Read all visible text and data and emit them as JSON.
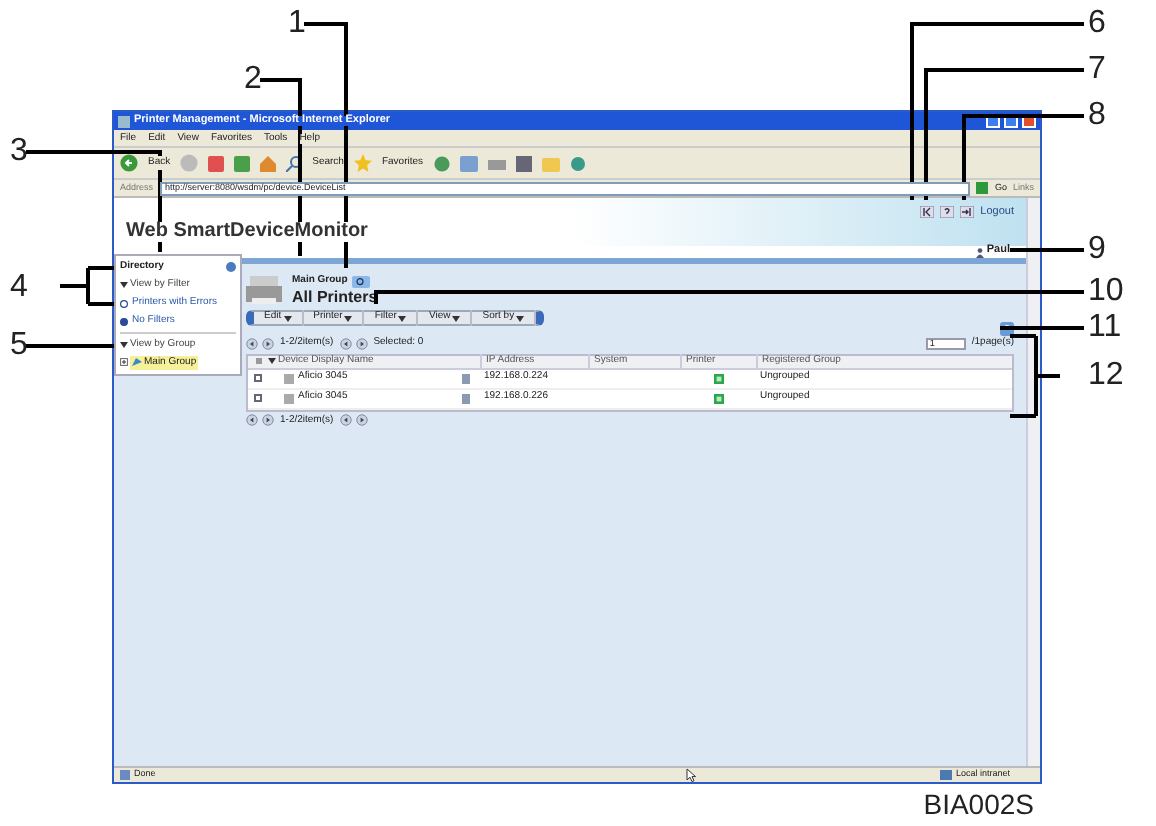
{
  "callouts": [
    "1",
    "2",
    "3",
    "4",
    "5",
    "6",
    "7",
    "8",
    "9",
    "10",
    "11",
    "12"
  ],
  "window": {
    "title": "Printer Management - Microsoft Internet Explorer"
  },
  "menu": [
    "File",
    "Edit",
    "View",
    "Favorites",
    "Tools",
    "Help"
  ],
  "toolbar": {
    "back": "Back",
    "search": "Search",
    "favorites": "Favorites"
  },
  "address": {
    "label": "Address",
    "value": "http://server:8080/wsdm/pc/device.DeviceList",
    "go": "Go",
    "links": "Links"
  },
  "app": {
    "title": "Web SmartDeviceMonitor",
    "logout": "Logout",
    "user": "Paul"
  },
  "sidebar": {
    "title": "Directory",
    "filter_label": "View by Filter",
    "filters": [
      {
        "label": "Printers with Errors",
        "selected": false
      },
      {
        "label": "No Filters",
        "selected": true
      }
    ],
    "group_label": "View by Group",
    "groups": [
      {
        "label": "Main Group",
        "selected": true
      }
    ]
  },
  "main": {
    "group": "Main Group",
    "heading": "All Printers",
    "menus": [
      "Edit",
      "Printer",
      "Filter",
      "View",
      "Sort by"
    ],
    "pager": "1-2/2item(s)",
    "selected": "Selected: 0",
    "page_input": "1",
    "page_total": "/1page(s)",
    "columns": [
      "Device Display Name",
      "IP Address",
      "System",
      "Printer",
      "Registered Group"
    ],
    "rows": [
      {
        "checked": false,
        "name": "Aficio 3045",
        "ip": "192.168.0.224",
        "group": "Ungrouped"
      },
      {
        "checked": false,
        "name": "Aficio 3045",
        "ip": "192.168.0.226",
        "group": "Ungrouped"
      }
    ],
    "pager_bottom": "1-2/2item(s)"
  },
  "status": {
    "left": "Done",
    "zone": "Local intranet"
  },
  "figure_code": "BIA002S"
}
